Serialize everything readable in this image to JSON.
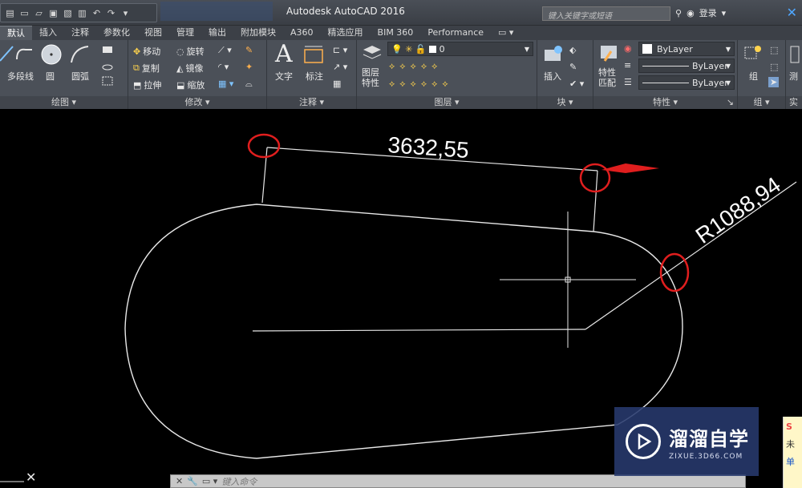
{
  "window": {
    "title": "Autodesk AutoCAD 2016",
    "search_placeholder": "键入关键字或短语",
    "sign_in": "登录"
  },
  "ribbon_tabs": [
    "默认",
    "插入",
    "注释",
    "参数化",
    "视图",
    "管理",
    "输出",
    "附加模块",
    "A360",
    "精选应用",
    "BIM 360",
    "Performance"
  ],
  "panels": {
    "draw": {
      "title": "绘图",
      "polyline": "多段线",
      "circle": "圆",
      "arc": "圆弧"
    },
    "modify": {
      "title": "修改",
      "move": "移动",
      "rotate": "旋转",
      "copy": "复制",
      "mirror": "镜像",
      "stretch": "拉伸",
      "scale": "缩放"
    },
    "annotation": {
      "title": "注释",
      "text": "文字",
      "dimension": "标注"
    },
    "layers": {
      "title": "图层",
      "layer_props_line1": "图层",
      "layer_props_line2": "特性",
      "current_layer": "0"
    },
    "block": {
      "title": "块",
      "insert": "插入"
    },
    "properties": {
      "title": "特性",
      "match_line1": "特性",
      "match_line2": "匹配",
      "color": "ByLayer",
      "linetype": "ByLayer",
      "lineweight": "ByLayer"
    },
    "groups": {
      "title": "组",
      "group": "组"
    },
    "utilities": {
      "title": "实",
      "measure": "测"
    }
  },
  "drawing": {
    "dim_linear": "3632,55",
    "dim_radius": "R1088,94"
  },
  "command_line": {
    "placeholder": "键入命令"
  },
  "watermark": {
    "title": "溜溜自学",
    "subtitle": "ZIXUE.3D66.COM"
  },
  "side_note": {
    "line1": "未",
    "line2": "单"
  },
  "colors": {
    "accent_red": "#e01e1e",
    "line": "#ffffff",
    "ribbon": "#4b5058"
  }
}
